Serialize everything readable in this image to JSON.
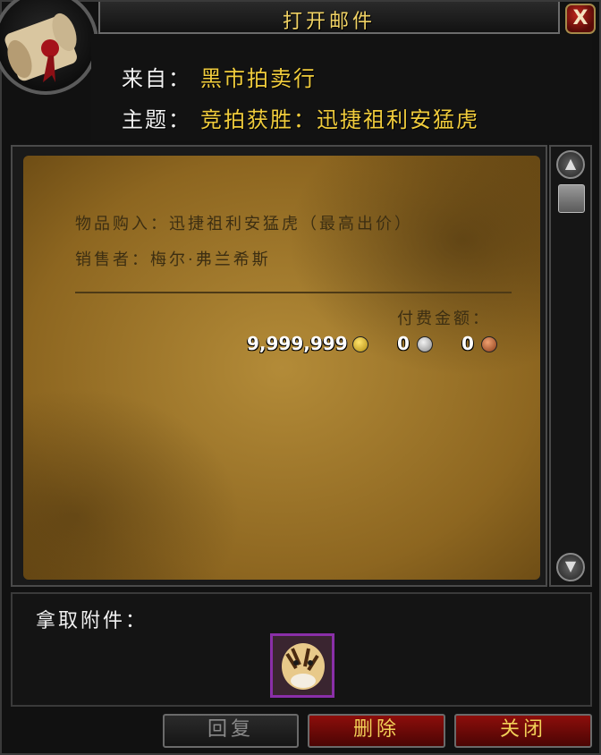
{
  "window": {
    "title": "打开邮件",
    "close_label": "X"
  },
  "header": {
    "from_label": "来自：",
    "from_value": "黑市拍卖行",
    "subject_label": "主题：",
    "subject_value": "竞拍获胜：迅捷祖利安猛虎"
  },
  "letter": {
    "line1": "物品购入：迅捷祖利安猛虎（最高出价）",
    "line2": "销售者：梅尔·弗兰希斯",
    "payment_label": "付费金额：",
    "gold": "9,999,999",
    "silver": "0",
    "copper": "0"
  },
  "attachments": {
    "label": "拿取附件：",
    "item_icon": "swift-zulian-tiger-icon"
  },
  "buttons": {
    "reply": "回复",
    "delete": "删除",
    "close": "关闭"
  },
  "colors": {
    "title_gold": "#f0d264",
    "value_gold": "#f0cc3c",
    "red_button": "#8d0e0b",
    "epic_purple": "#8a2fa8"
  }
}
